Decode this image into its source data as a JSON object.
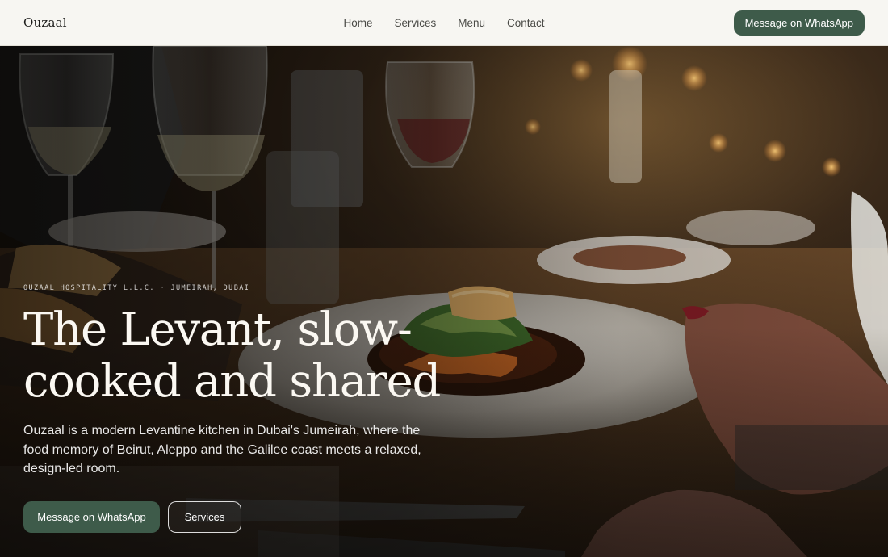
{
  "header": {
    "brand": "Ouzaal",
    "nav": [
      "Home",
      "Services",
      "Menu",
      "Contact"
    ],
    "cta_label": "Message on WhatsApp"
  },
  "hero": {
    "image_icon": "restaurant-table-photo",
    "eyebrow": "OUZAAL HOSPITALITY L.L.C. · JUMEIRAH, DUBAI",
    "headline_line1": "The Levant, slow-",
    "headline_line2": "cooked and shared",
    "lede": "Ouzaal is a modern Levantine kitchen in Dubai's Jumeirah, where the food memory of Beirut, Aleppo and the Galilee coast meets a relaxed, design-led room.",
    "primary_cta": "Message on WhatsApp",
    "secondary_cta": "Services"
  },
  "colors": {
    "accent": "#3e5b4a",
    "header_bg": "#f7f6f2",
    "text_dark": "#1c1c1a"
  }
}
